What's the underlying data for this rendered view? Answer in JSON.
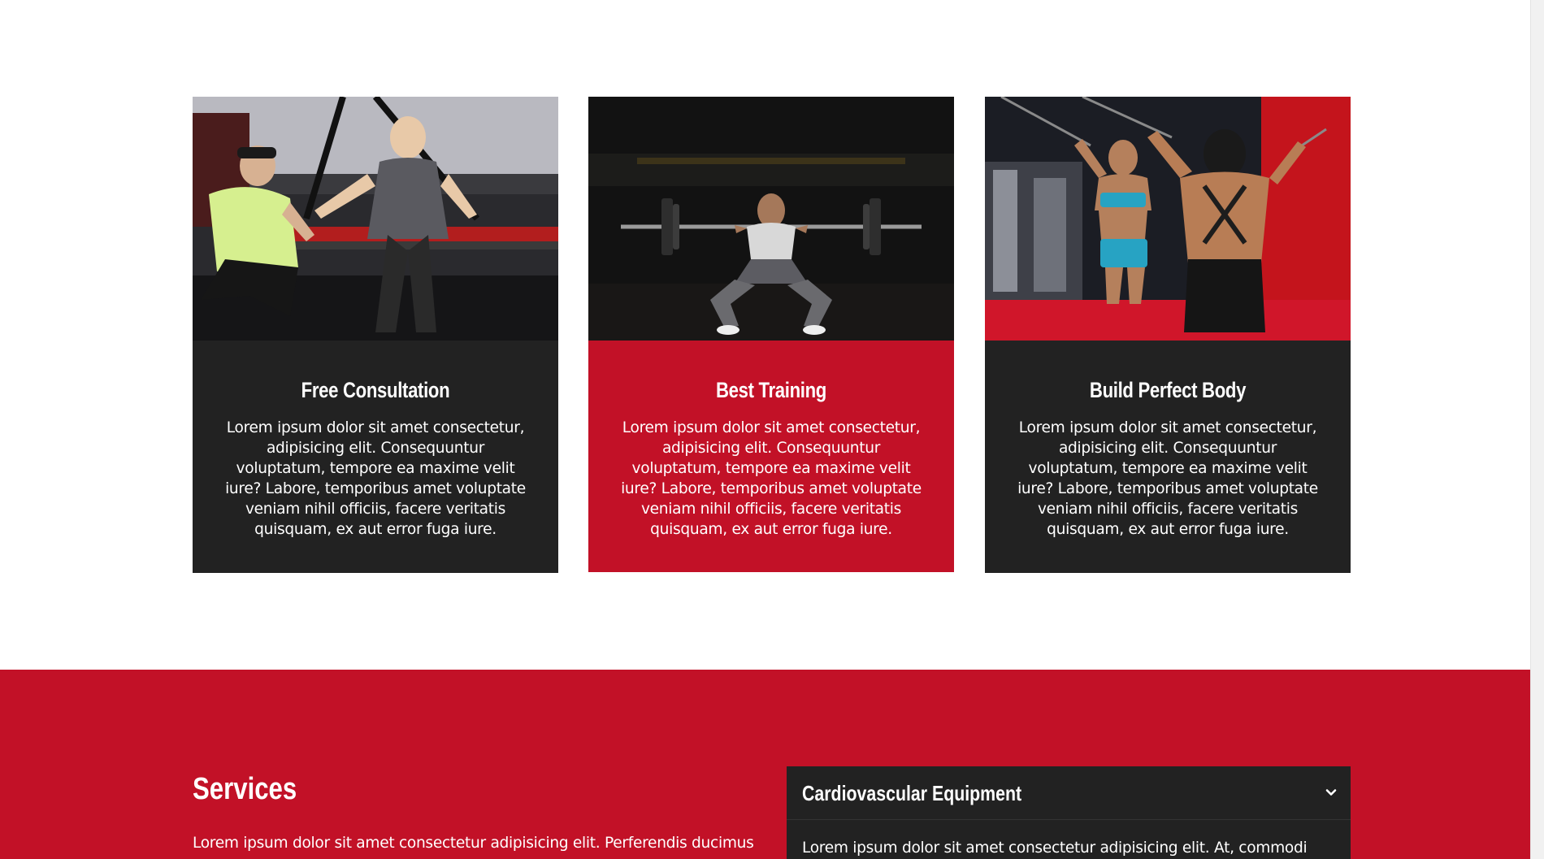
{
  "cards": [
    {
      "title": "Free Consultation",
      "text": "Lorem ipsum dolor sit amet consectetur, adipisicing elit. Consequuntur voluptatum, tempore ea maxime velit iure? Labore, temporibus amet voluptate veniam nihil officiis, facere veritatis quisquam, ex aut error fuga iure."
    },
    {
      "title": "Best Training",
      "text": "Lorem ipsum dolor sit amet consectetur, adipisicing elit. Consequuntur voluptatum, tempore ea maxime velit iure? Labore, temporibus amet voluptate veniam nihil officiis, facere veritatis quisquam, ex aut error fuga iure."
    },
    {
      "title": "Build Perfect Body",
      "text": "Lorem ipsum dolor sit amet consectetur, adipisicing elit. Consequuntur voluptatum, tempore ea maxime velit iure? Labore, temporibus amet voluptate veniam nihil officiis, facere veritatis quisquam, ex aut error fuga iure."
    }
  ],
  "services": {
    "title": "Services",
    "text": "Lorem ipsum dolor sit amet consectetur adipisicing elit. Perferendis ducimus",
    "accordion": {
      "title": "Cardiovascular Equipment",
      "icon": "chevron-down-icon",
      "body": "Lorem ipsum dolor sit amet consectetur adipisicing elit. At, commodi"
    }
  },
  "colors": {
    "brand_red": "#c21127",
    "card_dark": "#222222"
  }
}
